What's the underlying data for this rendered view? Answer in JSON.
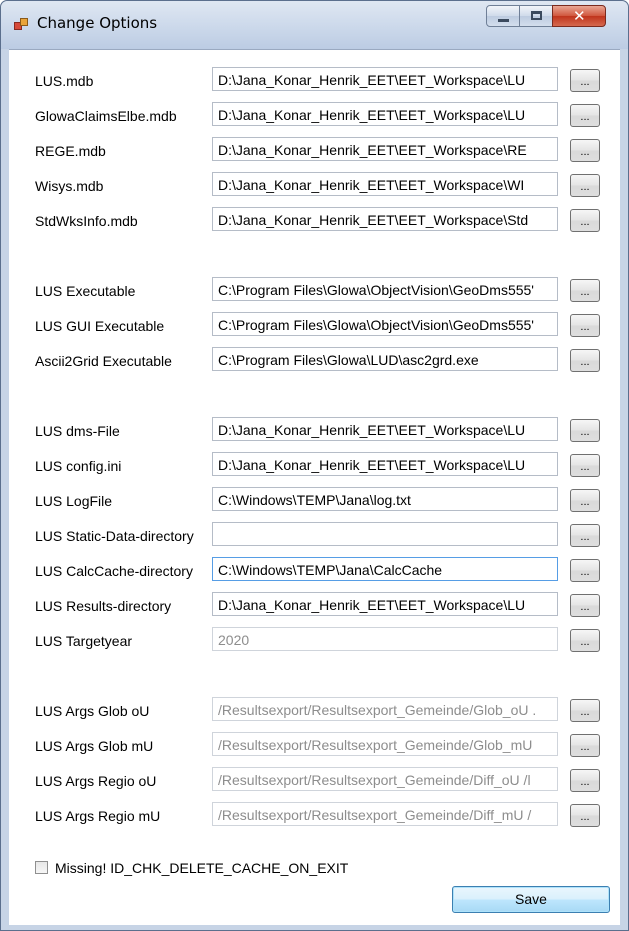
{
  "window": {
    "title": "Change Options"
  },
  "rows": [
    {
      "label": "LUS.mdb",
      "value": "D:\\Jana_Konar_Henrik_EET\\EET_Workspace\\LU",
      "state": "normal"
    },
    {
      "label": "GlowaClaimsElbe.mdb",
      "value": "D:\\Jana_Konar_Henrik_EET\\EET_Workspace\\LU",
      "state": "normal"
    },
    {
      "label": "REGE.mdb",
      "value": "D:\\Jana_Konar_Henrik_EET\\EET_Workspace\\RE",
      "state": "normal"
    },
    {
      "label": "Wisys.mdb",
      "value": "D:\\Jana_Konar_Henrik_EET\\EET_Workspace\\WI",
      "state": "normal"
    },
    {
      "label": "StdWksInfo.mdb",
      "value": "D:\\Jana_Konar_Henrik_EET\\EET_Workspace\\Std",
      "state": "normal"
    },
    {
      "label": "LUS Executable",
      "value": "C:\\Program Files\\Glowa\\ObjectVision\\GeoDms555'",
      "state": "normal"
    },
    {
      "label": "LUS GUI Executable",
      "value": "C:\\Program Files\\Glowa\\ObjectVision\\GeoDms555'",
      "state": "normal"
    },
    {
      "label": "Ascii2Grid Executable",
      "value": "C:\\Program Files\\Glowa\\LUD\\asc2grd.exe",
      "state": "normal"
    },
    {
      "label": "LUS dms-File",
      "value": "D:\\Jana_Konar_Henrik_EET\\EET_Workspace\\LU",
      "state": "normal"
    },
    {
      "label": "LUS config.ini",
      "value": "D:\\Jana_Konar_Henrik_EET\\EET_Workspace\\LU",
      "state": "normal"
    },
    {
      "label": "LUS LogFile",
      "value": "C:\\Windows\\TEMP\\Jana\\log.txt",
      "state": "normal"
    },
    {
      "label": "LUS Static-Data-directory",
      "value": "",
      "state": "normal"
    },
    {
      "label": "LUS CalcCache-directory",
      "value": "C:\\Windows\\TEMP\\Jana\\CalcCache",
      "state": "focused"
    },
    {
      "label": "LUS Results-directory",
      "value": "D:\\Jana_Konar_Henrik_EET\\EET_Workspace\\LU",
      "state": "normal"
    },
    {
      "label": "LUS Targetyear",
      "value": "2020",
      "state": "disabled"
    },
    {
      "label": "LUS Args Glob oU",
      "value": "/Resultsexport/Resultsexport_Gemeinde/Glob_oU .",
      "state": "disabled"
    },
    {
      "label": "LUS Args Glob mU",
      "value": "/Resultsexport/Resultsexport_Gemeinde/Glob_mU",
      "state": "disabled"
    },
    {
      "label": "LUS Args Regio oU",
      "value": "/Resultsexport/Resultsexport_Gemeinde/Diff_oU /l",
      "state": "disabled"
    },
    {
      "label": "LUS Args Regio mU",
      "value": "/Resultsexport/Resultsexport_Gemeinde/Diff_mU /",
      "state": "disabled"
    }
  ],
  "browse_label": "...",
  "checkbox": {
    "label": "Missing! ID_CHK_DELETE_CACHE_ON_EXIT",
    "checked": false
  },
  "save_label": "Save",
  "colors": {
    "window_frame": "#c7d4e6",
    "focus_border": "#569de5",
    "disabled_text": "#8d8d8d",
    "close_button": "#c0341c"
  }
}
